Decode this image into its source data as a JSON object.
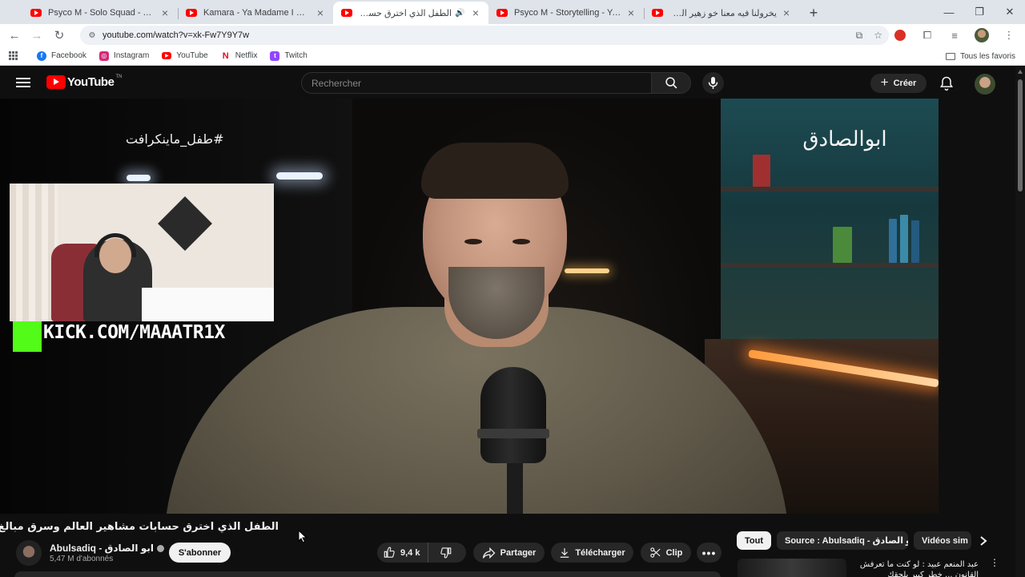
{
  "browser": {
    "tabs": [
      {
        "title": "Psyco M - Solo Squad - YouTube",
        "rtl": false,
        "audio": false,
        "active": false
      },
      {
        "title": "Kamara - Ya Madame I CESAR ...",
        "rtl": false,
        "audio": false,
        "active": false
      },
      {
        "title": "الطفل الذي اخترق حسابات مشاهير",
        "rtl": true,
        "audio": true,
        "active": true
      },
      {
        "title": "Psyco M - Storytelling - YouTube",
        "rtl": false,
        "audio": false,
        "active": false
      },
      {
        "title": "يخرولنا فيه معنا خو زهير الذوادي",
        "rtl": true,
        "audio": false,
        "active": false
      }
    ],
    "url": "youtube.com/watch?v=xk-Fw7Y9Y7w",
    "bookmarks": [
      {
        "label": "Facebook",
        "icon": "facebook-icon",
        "color": "#1877f2",
        "glyph": "f"
      },
      {
        "label": "Instagram",
        "icon": "instagram-icon",
        "color": "#d62976",
        "glyph": "◎"
      },
      {
        "label": "YouTube",
        "icon": "youtube-icon",
        "color": "#ff0000",
        "glyph": "▶"
      },
      {
        "label": "Netflix",
        "icon": "netflix-icon",
        "color": "#e50914",
        "glyph": "N"
      },
      {
        "label": "Twitch",
        "icon": "twitch-icon",
        "color": "#9146ff",
        "glyph": "t"
      }
    ],
    "all_bookmarks_label": "Tous les favoris"
  },
  "youtube": {
    "logo_text": "YouTube",
    "logo_tm": "TN",
    "search_placeholder": "Rechercher",
    "create_label": "Créer",
    "accent": "#ff0000"
  },
  "video": {
    "overlay_hashtag": "#طفل_ماينكرافت",
    "overlay_brand": "ابوالصادق",
    "webcam_url": "KICK.COM/MAAATR1X",
    "kick_color": "#53fc18",
    "title": "الطفل الذي اخترق حسابات مشاهير العالم وسرق مبالغ ضخمة",
    "channel_name": "Abulsadiq - ابو الصادق",
    "subscribers": "5,47 M d'abonnés",
    "subscribe_label": "S'abonner",
    "likes": "9,4 k",
    "share_label": "Partager",
    "download_label": "Télécharger",
    "clip_label": "Clip",
    "more_label": "•••"
  },
  "sidebar": {
    "chips": [
      "Tout",
      "Source : Abulsadiq - ابو الصادق",
      "Vidéos sim"
    ],
    "recommendation_title": "عبد المنعم عبيد : لو كنت ما تعرفش القانون ... خطر كبير يلحقك"
  }
}
